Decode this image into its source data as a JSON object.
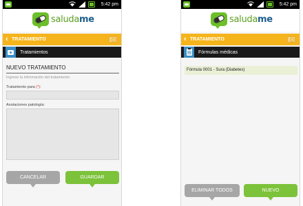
{
  "status": {
    "time": "5:42 pm"
  },
  "brand": {
    "logo_part1": "saluda",
    "logo_part2": "me"
  },
  "left_screen": {
    "header_title": "TRATAMIENTO",
    "section_title": "Tratamientos",
    "form_title": "NUEVO TRATAMIENTO",
    "form_hint": "Ingrese la información del tratamiento",
    "field1_label": "Tratamiento para ",
    "field1_required": "(*)",
    "field1_suffix": ":",
    "field2_label": "Anotaciones patología:",
    "cancel_label": "CANCELAR",
    "save_label": "GUARDAR"
  },
  "right_screen": {
    "header_title": "TRATAMIENTO",
    "section_title": "Fórmulas médicas",
    "items": [
      {
        "label": "Fórmula 0001 - Sura (Diabetes)"
      }
    ],
    "delete_all_label": "ELIMINAR TODOS",
    "new_label": "NUEVO"
  },
  "colors": {
    "accent_green": "#7cc23a",
    "header_orange": "#f5b41b",
    "icon_blue": "#3a8dc4"
  },
  "icons": [
    "app-notification-icon",
    "wifi-icon",
    "signal-icon",
    "battery-icon",
    "back-chevron-icon",
    "camera-icon",
    "clipboard-icon",
    "logo-pill-icon"
  ]
}
